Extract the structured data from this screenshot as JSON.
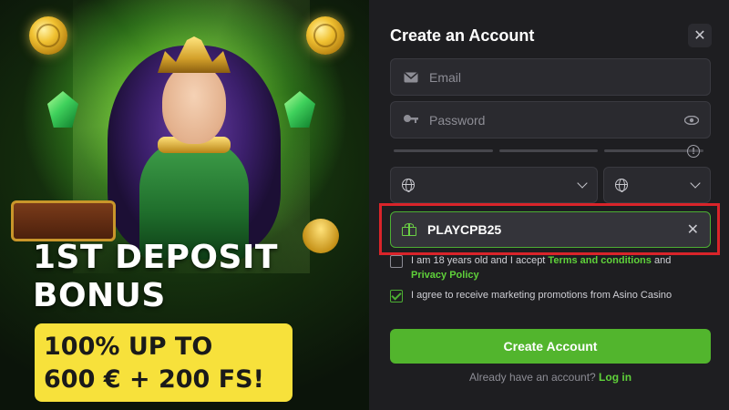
{
  "promo": {
    "headline_line1": "1ST DEPOSIT",
    "headline_line2": "BONUS",
    "offer_line1": "100% UP TO",
    "offer_line2": "600 € + 200 FS!",
    "offer_bg": "#f7e13b"
  },
  "form": {
    "title": "Create an Account",
    "close_icon": "close-icon",
    "email_placeholder": "Email",
    "password_placeholder": "Password",
    "promo_code": "PLAYCPB25",
    "terms": {
      "prefix": "I am 18 years old and I accept ",
      "terms_link": "Terms and conditions",
      "and": " and",
      "privacy_link": "Privacy Policy",
      "checked": false
    },
    "marketing": {
      "text": "I agree to receive marketing promotions from Asino Casino",
      "checked": true
    },
    "submit_label": "Create Account",
    "login_prompt": "Already have an account?",
    "login_link": "Log in"
  },
  "colors": {
    "accent_green": "#52b52d",
    "highlight_red": "#d9242a",
    "panel_bg": "#1e1e21"
  }
}
